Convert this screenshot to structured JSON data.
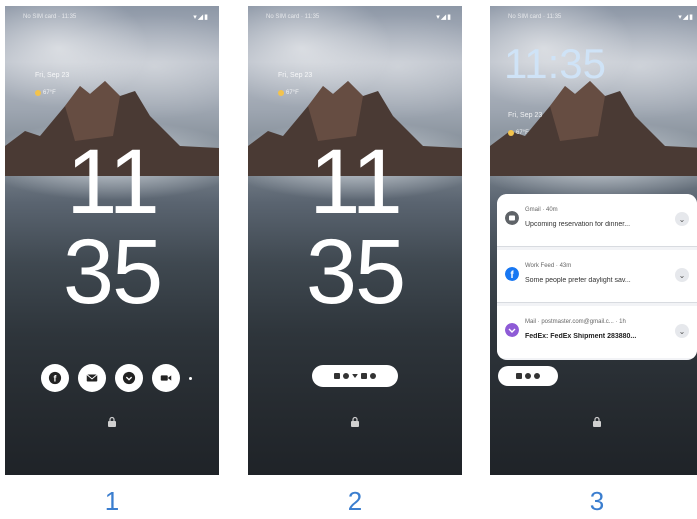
{
  "screens": [
    {
      "status_time": "No SIM card · 11:35",
      "status_icons": "▾◢▮",
      "date": "Fri, Sep 23",
      "weather": "67°F",
      "clock_hours": "11",
      "clock_minutes": "35",
      "notification_icons": [
        "facebook-icon",
        "mail-icon",
        "chevron-down-icon",
        "video-call-icon"
      ]
    },
    {
      "status_time": "No SIM card · 11:35",
      "status_icons": "▾◢▮",
      "date": "Fri, Sep 23",
      "weather": "67°F",
      "clock_hours": "11",
      "clock_minutes": "35",
      "pill_icons": [
        "mail-icon",
        "facebook-icon",
        "chevron-icon",
        "video-icon",
        "cloud-icon"
      ]
    },
    {
      "status_time": "No SIM card · 11:35",
      "status_icons": "▾◢▮",
      "clock": "11:35",
      "date": "Fri, Sep 23",
      "weather": "67°F",
      "notifications": [
        {
          "source": "Gmail · 40m",
          "message": "Upcoming reservation for dinner...",
          "icon": "gmail-icon",
          "color": "#5f6368"
        },
        {
          "source": "Work Feed · 43m",
          "message": "Some people prefer daylight sav...",
          "icon": "facebook-icon",
          "color": "#1877f2"
        },
        {
          "source": "Mail · postmaster.com@gmail.c... · 1h",
          "message": "FedEx: FedEx Shipment 283880...",
          "icon": "mail-icon",
          "color": "#8e5bd6"
        }
      ]
    }
  ],
  "labels": [
    "1",
    "2",
    "3"
  ]
}
